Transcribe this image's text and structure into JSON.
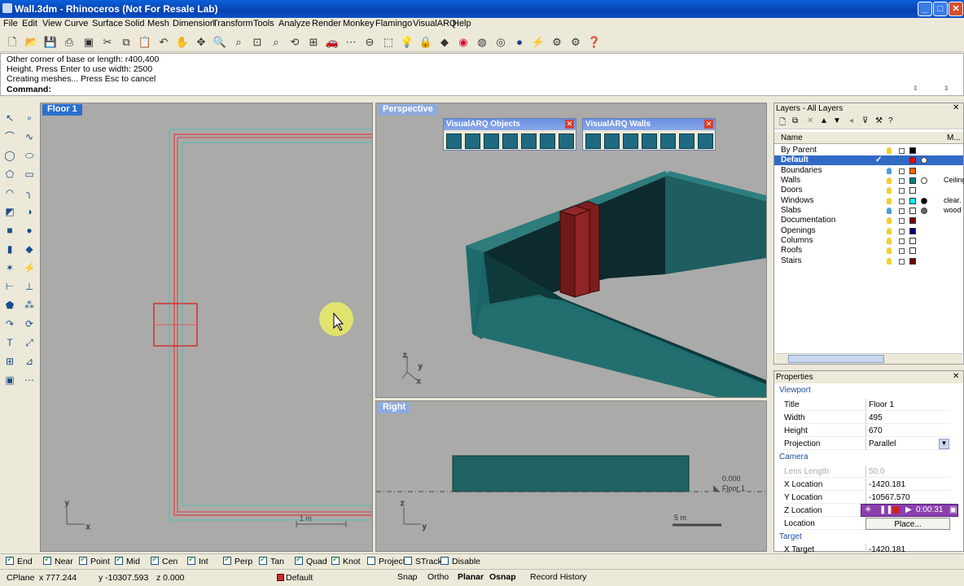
{
  "window": {
    "title": "Wall.3dm - Rhinoceros (Not For Resale Lab)"
  },
  "menu": [
    "File",
    "Edit",
    "View",
    "Curve",
    "Surface",
    "Solid",
    "Mesh",
    "Dimension",
    "Transform",
    "Tools",
    "Analyze",
    "Render",
    "Monkey",
    "Flamingo",
    "VisualARQ",
    "Help"
  ],
  "command": {
    "history": [
      "Other corner of base or length: r400,400",
      "Height. Press Enter to use width: 2500",
      "Creating meshes... Press Esc to cancel"
    ],
    "prompt": "Command:"
  },
  "viewports": {
    "floor1": {
      "title": "Floor 1",
      "scale": "1 m"
    },
    "perspective": {
      "title": "Perspective"
    },
    "right": {
      "title": "Right",
      "scale": "5 m",
      "level_value": "0.000",
      "level_name": "Floor 1"
    }
  },
  "floating_toolbars": [
    {
      "title": "VisualARQ Objects",
      "count": 7
    },
    {
      "title": "VisualARQ Walls",
      "count": 7
    }
  ],
  "layers": {
    "header": "Layers - All Layers",
    "columns": {
      "name": "Name",
      "material": "M..."
    },
    "items": [
      {
        "name": "By Parent",
        "color": "#000000",
        "material": ""
      },
      {
        "name": "Default",
        "color": "#ff0000",
        "material": "",
        "selected": true
      },
      {
        "name": "Boundaries",
        "color": "#ff6600",
        "material": ""
      },
      {
        "name": "Walls",
        "color": "#008080",
        "material": "Ceiling"
      },
      {
        "name": "Doors",
        "color": "#ffffff",
        "material": ""
      },
      {
        "name": "Windows",
        "color": "#00ffff",
        "material": "clear."
      },
      {
        "name": "Slabs",
        "color": "#ffffff",
        "material": "wood"
      },
      {
        "name": "Documentation",
        "color": "#7a0000",
        "material": ""
      },
      {
        "name": "Openings",
        "color": "#000080",
        "material": ""
      },
      {
        "name": "Columns",
        "color": "#ffffff",
        "material": ""
      },
      {
        "name": "Roofs",
        "color": "#ffffff",
        "material": ""
      },
      {
        "name": "Stairs",
        "color": "#7a0000",
        "material": ""
      }
    ]
  },
  "properties": {
    "header": "Properties",
    "section": "Viewport",
    "rows": [
      {
        "key": "Title",
        "value": "Floor 1"
      },
      {
        "key": "Width",
        "value": "495"
      },
      {
        "key": "Height",
        "value": "670"
      },
      {
        "key": "Projection",
        "value": "Parallel"
      }
    ],
    "camera_section": "Camera",
    "camera_rows": [
      {
        "key": "Lens Length",
        "value": "50.0",
        "disabled": true
      },
      {
        "key": "X Location",
        "value": "-1420.181"
      },
      {
        "key": "Y Location",
        "value": "-10567.570"
      },
      {
        "key": "Z Location",
        "value": ""
      },
      {
        "key": "Location",
        "value": "Place..."
      }
    ],
    "target_section": "Target",
    "target_rows": [
      {
        "key": "X Target",
        "value": "-1420.181"
      }
    ]
  },
  "recorder": {
    "time": "0:00:31"
  },
  "osnaps": [
    {
      "label": "End",
      "on": true
    },
    {
      "label": "Near",
      "on": true
    },
    {
      "label": "Point",
      "on": true
    },
    {
      "label": "Mid",
      "on": true
    },
    {
      "label": "Cen",
      "on": true
    },
    {
      "label": "Int",
      "on": true
    },
    {
      "label": "Perp",
      "on": true
    },
    {
      "label": "Tan",
      "on": true
    },
    {
      "label": "Quad",
      "on": true
    },
    {
      "label": "Knot",
      "on": true
    },
    {
      "label": "Project",
      "on": false
    },
    {
      "label": "STrack",
      "on": false
    },
    {
      "label": "Disable",
      "on": false
    }
  ],
  "status": {
    "cplane": "CPlane",
    "x": "x 777.244",
    "y": "y -10307.593",
    "z": "z 0.000",
    "layer": "Default",
    "layer_color": "#c03030",
    "toggles": [
      {
        "label": "Snap",
        "bold": false
      },
      {
        "label": "Ortho",
        "bold": false
      },
      {
        "label": "Planar",
        "bold": true
      },
      {
        "label": "Osnap",
        "bold": true
      },
      {
        "label": "Record History",
        "bold": false
      }
    ]
  }
}
